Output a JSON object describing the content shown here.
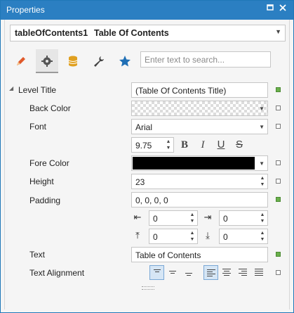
{
  "window": {
    "title": "Properties",
    "pin_icon": "pin-icon",
    "close_icon": "close-icon"
  },
  "selector": {
    "name": "tableOfContents1",
    "type": "Table Of Contents"
  },
  "tabs": [
    {
      "id": "appearance",
      "icon": "pencil-icon",
      "color": "#e05a2b"
    },
    {
      "id": "behavior",
      "icon": "gear-icon",
      "color": "#555555",
      "active": true
    },
    {
      "id": "data",
      "icon": "database-icon",
      "color": "#e0a020"
    },
    {
      "id": "layout",
      "icon": "wrench-icon",
      "color": "#444444"
    },
    {
      "id": "favorites",
      "icon": "star-icon",
      "color": "#1f6fb5"
    }
  ],
  "search": {
    "placeholder": "Enter text to search..."
  },
  "properties": {
    "level_title": {
      "label": "Level Title",
      "value": "(Table Of Contents Title)"
    },
    "back_color": {
      "label": "Back Color"
    },
    "font": {
      "label": "Font",
      "value": "Arial",
      "size": "9.75",
      "bold": "B",
      "italic": "I",
      "underline": "U",
      "strike": "S"
    },
    "fore_color": {
      "label": "Fore Color",
      "color": "#000000"
    },
    "height": {
      "label": "Height",
      "value": "23"
    },
    "padding": {
      "label": "Padding",
      "value": "0, 0, 0, 0",
      "left": "0",
      "right": "0",
      "top": "0",
      "bottom": "0"
    },
    "text": {
      "label": "Text",
      "value": "Table of Contents"
    },
    "text_alignment": {
      "label": "Text Alignment"
    }
  },
  "colors": {
    "title_bar": "#2b7fc2",
    "set_marker": "#6ab04c"
  }
}
